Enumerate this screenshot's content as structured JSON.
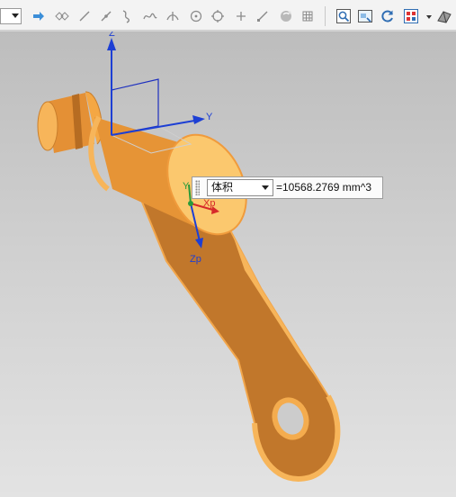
{
  "toolbar": {
    "items": [
      {
        "icon": "selection-filter-dropdown"
      },
      {
        "icon": "forward-arrow-icon"
      },
      {
        "icon": "snap-point-icon"
      },
      {
        "icon": "line-icon"
      },
      {
        "icon": "point-on-curve-icon"
      },
      {
        "icon": "curve-icon"
      },
      {
        "icon": "spline-icon"
      },
      {
        "icon": "intersection-icon"
      },
      {
        "icon": "circle-center-icon"
      },
      {
        "icon": "quadrant-point-icon"
      },
      {
        "icon": "existing-point-icon"
      },
      {
        "icon": "end-point-icon"
      },
      {
        "icon": "view-orientation-icon"
      },
      {
        "icon": "grid-icon"
      },
      {
        "icon": "zoom-view-icon"
      },
      {
        "icon": "view-preview-icon"
      },
      {
        "icon": "refresh-icon"
      },
      {
        "icon": "layout-icon"
      },
      {
        "icon": "render-style-icon"
      }
    ]
  },
  "viewport": {
    "wcs_labels": {
      "z": "Z",
      "y": "Y"
    },
    "csys_labels": {
      "xp": "Xp",
      "yp": "Y",
      "zp": "Zp"
    },
    "part_color": "#f5a43a"
  },
  "measure": {
    "dropdown_value": "体积",
    "result": "=10568.2769 mm^3"
  }
}
